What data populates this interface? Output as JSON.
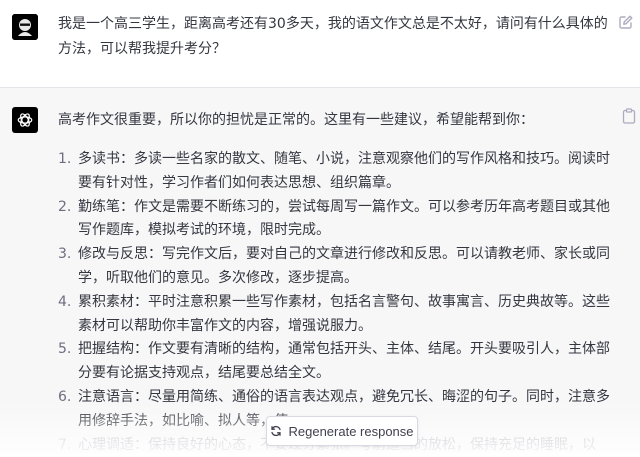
{
  "conversation": {
    "user_message": "我是一个高三学生，距离高考还有30多天，我的语文作文总是不太好，请问有什么具体的方法，可以帮我提升考分？",
    "assistant": {
      "intro": "高考作文很重要，所以你的担忧是正常的。这里有一些建议，希望能帮到你：",
      "tips": [
        {
          "num": "1.",
          "text": "多读书：多读一些名家的散文、随笔、小说，注意观察他们的写作风格和技巧。阅读时要有针对性，学习作者们如何表达思想、组织篇章。"
        },
        {
          "num": "2.",
          "text": "勤练笔：作文是需要不断练习的，尝试每周写一篇作文。可以参考历年高考题目或其他写作题库，模拟考试的环境，限时完成。"
        },
        {
          "num": "3.",
          "text": "修改与反思：写完作文后，要对自己的文章进行修改和反思。可以请教老师、家长或同学，听取他们的意见。多次修改，逐步提高。"
        },
        {
          "num": "4.",
          "text": "累积素材：平时注意积累一些写作素材，包括名言警句、故事寓言、历史典故等。这些素材可以帮助你丰富作文的内容，增强说服力。"
        },
        {
          "num": "5.",
          "text": "把握结构：作文要有清晰的结构，通常包括开头、主体、结尾。开头要吸引人，主体部分要有论据支持观点，结尾要总结全文。"
        },
        {
          "num": "6.",
          "text": "注意语言：尽量用简练、通俗的语言表达观点，避免冗长、晦涩的句子。同时，注意多用修辞手法，如比喻、拟人等，使"
        },
        {
          "num": "7.",
          "text": "心理调适：保持良好的心态，不要过分紧张。考前适当的放松，保持充足的睡眠，以"
        }
      ]
    }
  },
  "regenerate_button": {
    "label": "Regenerate response"
  },
  "icons": {
    "user_avatar": "user-avatar-icon",
    "assistant_avatar": "openai-logo-icon",
    "edit": "edit-icon",
    "copy": "clipboard-icon",
    "regenerate": "refresh-icon"
  },
  "colors": {
    "assistant_bg": "#f7f7f8",
    "text": "#353740",
    "avatar_bg": "#000000"
  }
}
